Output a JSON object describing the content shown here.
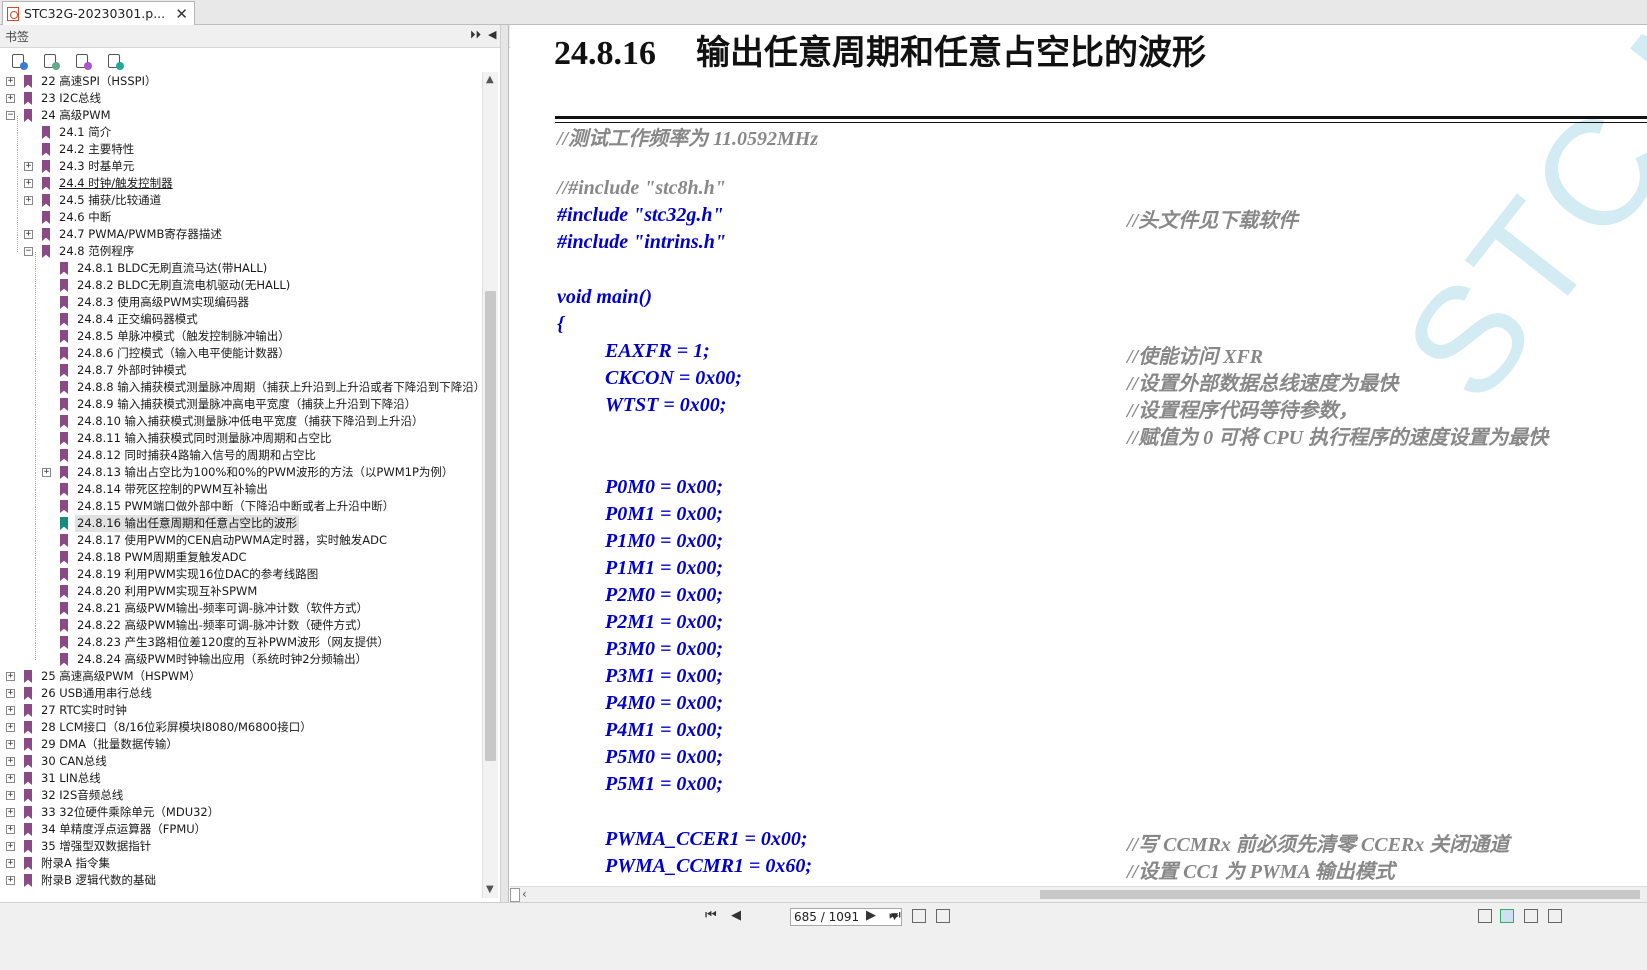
{
  "tab": {
    "title": "STC32G-20230301.p...",
    "close": "✕"
  },
  "pane": {
    "title": "书签",
    "expand_icon": "⏵⏵",
    "collapse_icon": "◀"
  },
  "bookmarks": [
    {
      "label": "22 高速SPI（HSSPI）",
      "level": 0,
      "expander": "+"
    },
    {
      "label": "23 I2C总线",
      "level": 0,
      "expander": "+"
    },
    {
      "label": "24 高级PWM",
      "level": 0,
      "expander": "−"
    },
    {
      "label": "24.1 简介",
      "level": 1,
      "expander": ""
    },
    {
      "label": "24.2 主要特性",
      "level": 1,
      "expander": ""
    },
    {
      "label": "24.3 时基单元",
      "level": 1,
      "expander": "+"
    },
    {
      "label": "24.4 时钟/触发控制器",
      "level": 1,
      "expander": "+",
      "underline": true
    },
    {
      "label": "24.5 捕获/比较通道",
      "level": 1,
      "expander": "+"
    },
    {
      "label": "24.6 中断",
      "level": 1,
      "expander": ""
    },
    {
      "label": "24.7 PWMA/PWMB寄存器描述",
      "level": 1,
      "expander": "+"
    },
    {
      "label": "24.8 范例程序",
      "level": 1,
      "expander": "−"
    },
    {
      "label": "24.8.1 BLDC无刷直流马达(带HALL)",
      "level": 2,
      "expander": ""
    },
    {
      "label": "24.8.2 BLDC无刷直流电机驱动(无HALL)",
      "level": 2,
      "expander": ""
    },
    {
      "label": "24.8.3 使用高级PWM实现编码器",
      "level": 2,
      "expander": ""
    },
    {
      "label": "24.8.4 正交编码器模式",
      "level": 2,
      "expander": ""
    },
    {
      "label": "24.8.5 单脉冲模式（触发控制脉冲输出）",
      "level": 2,
      "expander": ""
    },
    {
      "label": "24.8.6 门控模式（输入电平使能计数器）",
      "level": 2,
      "expander": ""
    },
    {
      "label": "24.8.7 外部时钟模式",
      "level": 2,
      "expander": ""
    },
    {
      "label": "24.8.8 输入捕获模式测量脉冲周期（捕获上升沿到上升沿或者下降沿到下降沿）",
      "level": 2,
      "expander": ""
    },
    {
      "label": "24.8.9 输入捕获模式测量脉冲高电平宽度（捕获上升沿到下降沿）",
      "level": 2,
      "expander": ""
    },
    {
      "label": "24.8.10 输入捕获模式测量脉冲低电平宽度（捕获下降沿到上升沿）",
      "level": 2,
      "expander": ""
    },
    {
      "label": "24.8.11 输入捕获模式同时测量脉冲周期和占空比",
      "level": 2,
      "expander": ""
    },
    {
      "label": "24.8.12 同时捕获4路输入信号的周期和占空比",
      "level": 2,
      "expander": ""
    },
    {
      "label": "24.8.13 输出占空比为100%和0%的PWM波形的方法（以PWM1P为例）",
      "level": 2,
      "expander": "+"
    },
    {
      "label": "24.8.14 带死区控制的PWM互补输出",
      "level": 2,
      "expander": ""
    },
    {
      "label": "24.8.15 PWM端口做外部中断（下降沿中断或者上升沿中断）",
      "level": 2,
      "expander": ""
    },
    {
      "label": "24.8.16 输出任意周期和任意占空比的波形",
      "level": 2,
      "expander": "",
      "selected": true
    },
    {
      "label": "24.8.17 使用PWM的CEN启动PWMA定时器，实时触发ADC",
      "level": 2,
      "expander": ""
    },
    {
      "label": "24.8.18 PWM周期重复触发ADC",
      "level": 2,
      "expander": ""
    },
    {
      "label": "24.8.19 利用PWM实现16位DAC的参考线路图",
      "level": 2,
      "expander": ""
    },
    {
      "label": "24.8.20 利用PWM实现互补SPWM",
      "level": 2,
      "expander": ""
    },
    {
      "label": "24.8.21 高级PWM输出-频率可调-脉冲计数（软件方式）",
      "level": 2,
      "expander": ""
    },
    {
      "label": "24.8.22 高级PWM输出-频率可调-脉冲计数（硬件方式）",
      "level": 2,
      "expander": ""
    },
    {
      "label": "24.8.23 产生3路相位差120度的互补PWM波形（网友提供）",
      "level": 2,
      "expander": ""
    },
    {
      "label": "24.8.24 高级PWM时钟输出应用（系统时钟2分频输出）",
      "level": 2,
      "expander": ""
    },
    {
      "label": "25 高速高级PWM（HSPWM）",
      "level": 0,
      "expander": "+"
    },
    {
      "label": "26 USB通用串行总线",
      "level": 0,
      "expander": "+"
    },
    {
      "label": "27 RTC实时时钟",
      "level": 0,
      "expander": "+"
    },
    {
      "label": "28 LCM接口（8/16位彩屏模块I8080/M6800接口）",
      "level": 0,
      "expander": "+"
    },
    {
      "label": "29 DMA（批量数据传输）",
      "level": 0,
      "expander": "+"
    },
    {
      "label": "30 CAN总线",
      "level": 0,
      "expander": "+"
    },
    {
      "label": "31 LIN总线",
      "level": 0,
      "expander": "+"
    },
    {
      "label": "32 I2S音频总线",
      "level": 0,
      "expander": "+"
    },
    {
      "label": "33 32位硬件乘除单元（MDU32）",
      "level": 0,
      "expander": "+"
    },
    {
      "label": "34 单精度浮点运算器（FPMU）",
      "level": 0,
      "expander": "+"
    },
    {
      "label": "35 增强型双数据指针",
      "level": 0,
      "expander": "+"
    },
    {
      "label": "附录A 指令集",
      "level": 0,
      "expander": "+"
    },
    {
      "label": "附录B 逻辑代数的基础",
      "level": 0,
      "expander": "+"
    }
  ],
  "document": {
    "section_number": "24.8.16",
    "section_title": "输出任意周期和任意占空比的波形",
    "watermark": "STC MCU",
    "code_lines": [
      {
        "text": "//测试工作频率为 11.0592MHz",
        "indent": 0,
        "comment": true
      },
      {
        "text": "//#include \"stc8h.h\"",
        "indent": 0,
        "comment": true
      },
      {
        "text": "#include \"stc32g.h\"",
        "indent": 0,
        "comment": false,
        "trail": "//头文件见下载软件"
      },
      {
        "text": "#include \"intrins.h\"",
        "indent": 0,
        "comment": false
      },
      {
        "text": "void main()",
        "indent": 0,
        "comment": false
      },
      {
        "text": "{",
        "indent": 0,
        "comment": false
      },
      {
        "text": "EAXFR = 1;",
        "indent": 1,
        "comment": false,
        "trail": "//使能访问 XFR"
      },
      {
        "text": "CKCON = 0x00;",
        "indent": 1,
        "comment": false,
        "trail": "//设置外部数据总线速度为最快"
      },
      {
        "text": "WTST = 0x00;",
        "indent": 1,
        "comment": false,
        "trail": "//设置程序代码等待参数，"
      },
      {
        "text": "",
        "indent": 1,
        "comment": false,
        "trail": "//赋值为 0 可将 CPU 执行程序的速度设置为最快"
      },
      {
        "text": "P0M0 = 0x00;",
        "indent": 1,
        "comment": false
      },
      {
        "text": "P0M1 = 0x00;",
        "indent": 1,
        "comment": false
      },
      {
        "text": "P1M0 = 0x00;",
        "indent": 1,
        "comment": false
      },
      {
        "text": "P1M1 = 0x00;",
        "indent": 1,
        "comment": false
      },
      {
        "text": "P2M0 = 0x00;",
        "indent": 1,
        "comment": false
      },
      {
        "text": "P2M1 = 0x00;",
        "indent": 1,
        "comment": false
      },
      {
        "text": "P3M0 = 0x00;",
        "indent": 1,
        "comment": false
      },
      {
        "text": "P3M1 = 0x00;",
        "indent": 1,
        "comment": false
      },
      {
        "text": "P4M0 = 0x00;",
        "indent": 1,
        "comment": false
      },
      {
        "text": "P4M1 = 0x00;",
        "indent": 1,
        "comment": false
      },
      {
        "text": "P5M0 = 0x00;",
        "indent": 1,
        "comment": false
      },
      {
        "text": "P5M1 = 0x00;",
        "indent": 1,
        "comment": false
      },
      {
        "text": "PWMA_CCER1 = 0x00;",
        "indent": 1,
        "comment": false,
        "trail": "//写 CCMRx 前必须先清零 CCERx 关闭通道"
      },
      {
        "text": "PWMA_CCMR1 = 0x60;",
        "indent": 1,
        "comment": false,
        "trail": "//设置 CC1 为 PWMA 输出模式"
      }
    ]
  },
  "statusbar": {
    "page_indicator": "685 / 1091",
    "first_icon": "⏮",
    "prev_icon": "◀",
    "next_icon": "▶",
    "last_icon": "⏭"
  }
}
